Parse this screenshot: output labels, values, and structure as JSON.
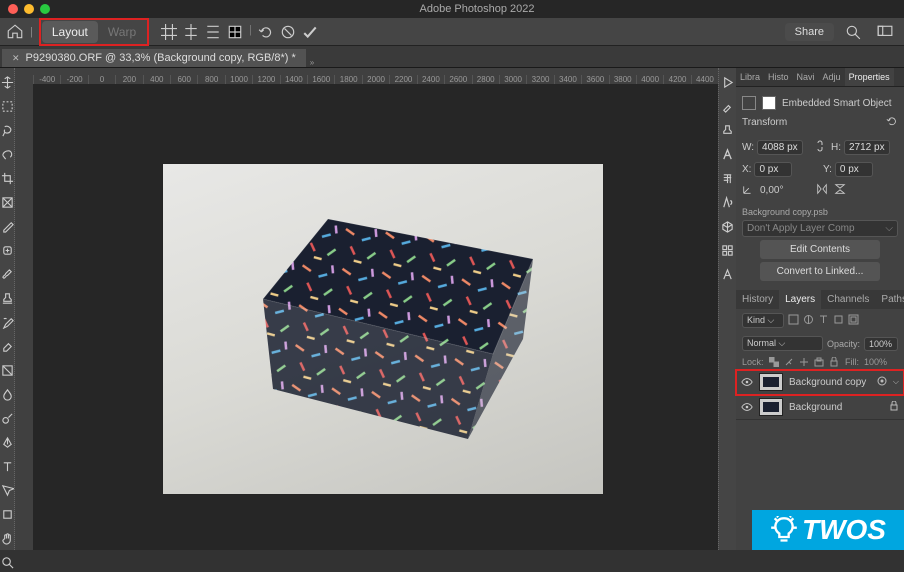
{
  "app": {
    "title": "Adobe Photoshop 2022"
  },
  "window_buttons": {
    "close": "#ff5f57",
    "min": "#febc2e",
    "max": "#28c840"
  },
  "options_bar": {
    "layout_label": "Layout",
    "warp_label": "Warp",
    "share_label": "Share"
  },
  "document": {
    "tab_label": "P9290380.ORF @ 33,3% (Background copy, RGB/8*) *"
  },
  "ruler_ticks": [
    "-400",
    "-200",
    "0",
    "200",
    "400",
    "600",
    "800",
    "1000",
    "1200",
    "1400",
    "1600",
    "1800",
    "2000",
    "2200",
    "2400",
    "2600",
    "2800",
    "3000",
    "3200",
    "3400",
    "3600",
    "3800",
    "4000",
    "4200",
    "4400"
  ],
  "properties": {
    "tabs": [
      "Libra",
      "Histo",
      "Navi",
      "Adju",
      "Properties"
    ],
    "active_tab": "Properties",
    "object_label": "Embedded Smart Object",
    "transform_label": "Transform",
    "w_label": "W:",
    "w_value": "4088 px",
    "h_label": "H:",
    "h_value": "2712 px",
    "x_label": "X:",
    "x_value": "0 px",
    "y_label": "Y:",
    "y_value": "0 px",
    "angle_value": "0,00°",
    "source_file": "Background copy.psb",
    "layer_comp_placeholder": "Don't Apply Layer Comp",
    "edit_btn": "Edit Contents",
    "convert_btn": "Convert to Linked..."
  },
  "layers_panel": {
    "tabs": [
      "History",
      "Layers",
      "Channels",
      "Paths"
    ],
    "active_tab": "Layers",
    "kind_label": "Kind",
    "blend_mode": "Normal",
    "opacity_label": "Opacity:",
    "opacity_value": "100%",
    "lock_label": "Lock:",
    "fill_label": "Fill:",
    "fill_value": "100%",
    "layers": [
      {
        "name": "Background copy",
        "visible": true,
        "smart": true,
        "locked": false,
        "selected": true
      },
      {
        "name": "Background",
        "visible": true,
        "smart": false,
        "locked": true,
        "selected": false
      }
    ]
  },
  "watermark": {
    "text": "TWOS"
  }
}
